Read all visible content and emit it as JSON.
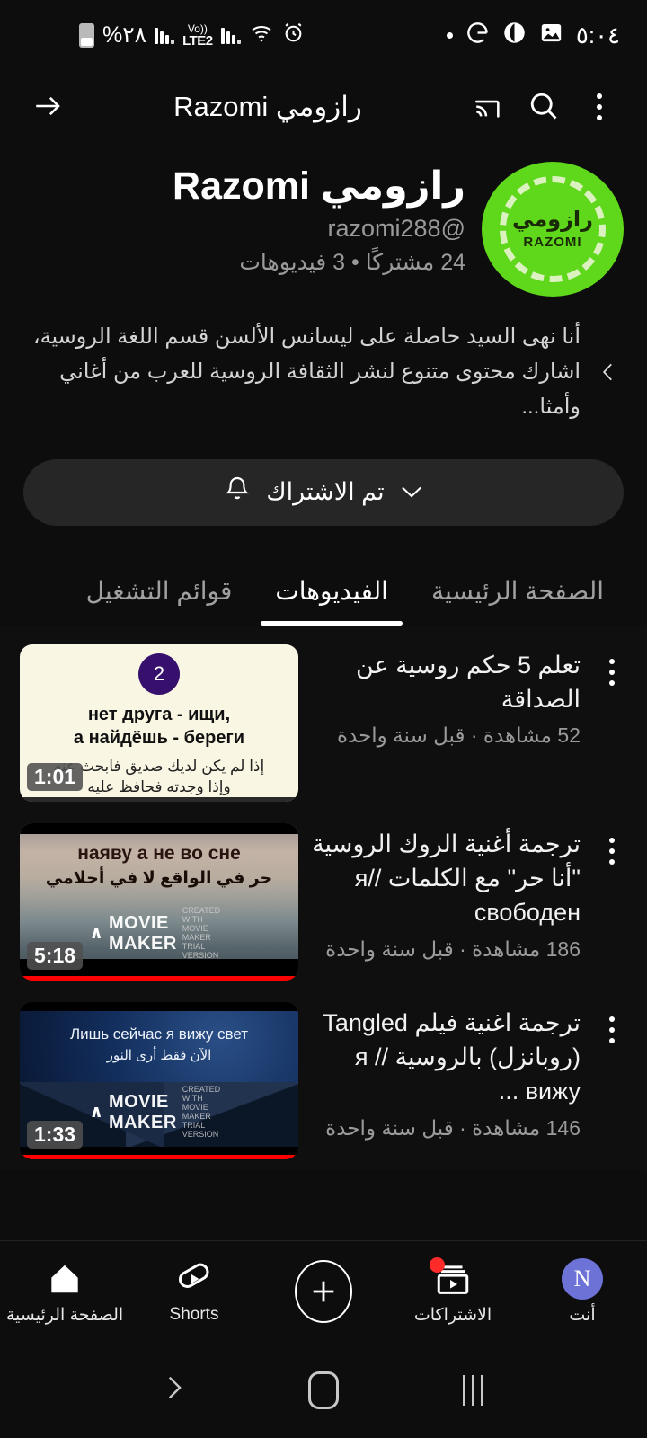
{
  "status_bar": {
    "battery_percent": "%٢٨",
    "network_label": "LTE2",
    "volte_label": "Vo))",
    "time": "٥:٠٤",
    "icons": [
      "battery-icon",
      "signal-bars-icon",
      "volte-icon",
      "signal-bars-2-icon",
      "wifi-icon",
      "alarm-icon",
      "dot-icon",
      "google-icon",
      "app-icon",
      "gallery-icon"
    ]
  },
  "app_bar": {
    "title": "رازومي Razomi",
    "menu_label": "المزيد",
    "search_label": "بحث",
    "cast_label": "إرسال",
    "back_label": "رجوع"
  },
  "channel": {
    "name": "رازومي Razomi",
    "handle": "@razomi288",
    "stats": "24 مشتركًا • 3 فيديوهات",
    "avatar": {
      "arabic": "رازومي",
      "latin": "RAZOMI",
      "bg_color": "#5fd81b"
    },
    "description": "أنا نهى السيد حاصلة على ليسانس الألسن قسم اللغة الروسية، اشارك محتوى متنوع لنشر الثقافة الروسية للعرب من أغاني وأمثا...",
    "subscribe_button": {
      "label": "تم الاشتراك",
      "bell": "bell-icon",
      "chevron": "chevron-down-icon"
    }
  },
  "tabs": [
    {
      "label": "الصفحة الرئيسية",
      "active": false
    },
    {
      "label": "الفيديوهات",
      "active": true
    },
    {
      "label": "قوائم التشغيل",
      "active": false
    }
  ],
  "videos": [
    {
      "title": "تعلم 5 حكم روسية عن الصداقة",
      "meta": "52 مشاهدة · قبل سنة واحدة",
      "duration": "1:01",
      "thumb": {
        "style": "cream-proverb",
        "badge": "2",
        "russian": "нет друга - ищи,\nа найдёшь - береги",
        "russian_line1": "нет друга - ищи,",
        "russian_line2": "а найдёшь - береги",
        "arabic_line1": "إذا لم يكن لديك صديق فابحث عنه",
        "arabic_line2": "وإذا وجدته فحافظ عليه",
        "bg_color": "#faf6e4",
        "badge_color": "#37106e"
      }
    },
    {
      "title": "ترجمة أغنية الروك الروسية \"أنا حر\" مع الكلمات //я свободен",
      "meta": "186 مشاهدة · قبل سنة واحدة",
      "duration": "5:18",
      "thumb": {
        "style": "beach",
        "russian": "наяву а не во сне",
        "arabic": "حر في الواقع لا في أحلامي",
        "watermark": "MOVIE MAKER",
        "watermark_sub1": "CREATED WITH",
        "watermark_sub2": "MOVIE MAKER TRIAL VERSION"
      }
    },
    {
      "title": "ترجمة اغنية فيلم Tangled (روبانزل) بالروسية // я вижу ...",
      "meta": "146 مشاهدة · قبل سنة واحدة",
      "duration": "1:33",
      "thumb": {
        "style": "night-sky",
        "russian": "Лишь сейчас я вижу свет",
        "arabic": "الآن فقط أرى النور",
        "watermark": "MOVIE MAKER",
        "watermark_sub1": "CREATED WITH",
        "watermark_sub2": "MOVIE MAKER TRIAL VERSION"
      }
    }
  ],
  "bottom_nav": [
    {
      "label": "الصفحة الرئيسية",
      "icon": "home-icon",
      "active": true
    },
    {
      "label": "Shorts",
      "icon": "shorts-icon",
      "active": false
    },
    {
      "label": "",
      "icon": "create-plus-icon",
      "active": false
    },
    {
      "label": "الاشتراكات",
      "icon": "subscriptions-icon",
      "badge": true,
      "active": false
    },
    {
      "label": "أنت",
      "icon": "account-avatar",
      "avatar_letter": "N",
      "avatar_color": "#6d73d6",
      "active": false
    }
  ],
  "system_nav": {
    "recents": "recents-icon",
    "home": "home-pill-icon",
    "back": "back-chevron-icon"
  }
}
